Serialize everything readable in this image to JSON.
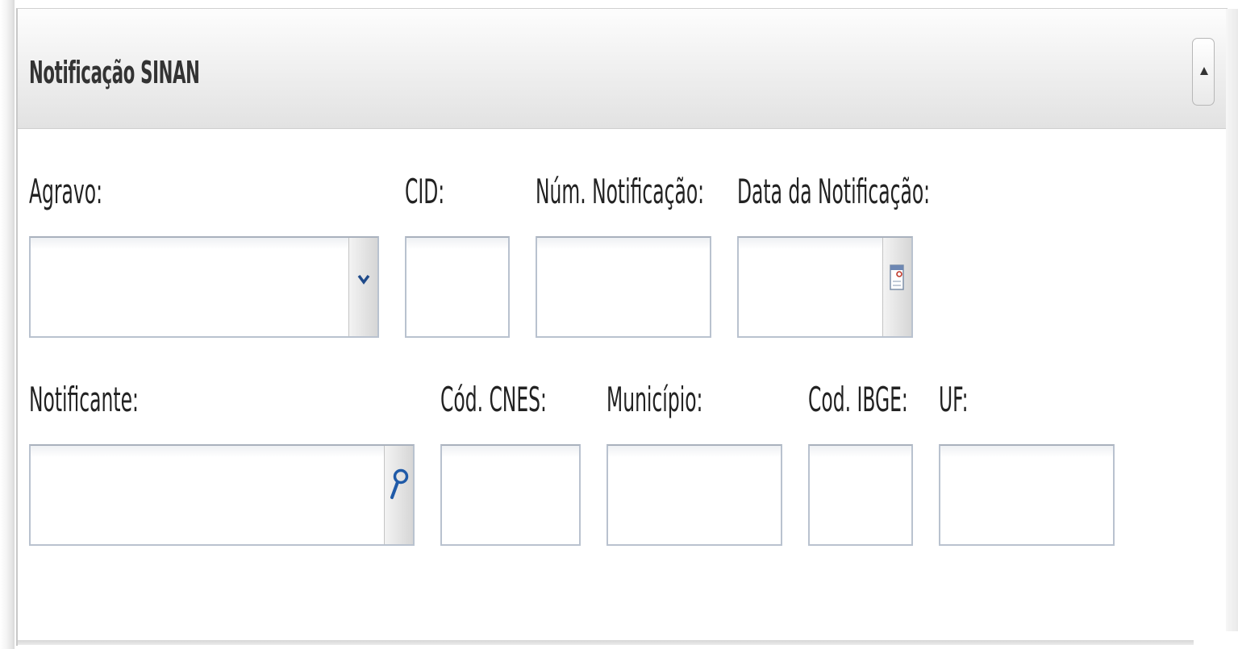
{
  "panel": {
    "title": "Notificação SINAN"
  },
  "fields": {
    "agravo": {
      "label": "Agravo:",
      "value": ""
    },
    "cid": {
      "label": "CID:",
      "value": ""
    },
    "num_notificacao": {
      "label": "Núm. Notificação:",
      "value": ""
    },
    "data_notificacao": {
      "label": "Data da Notificação:",
      "value": ""
    },
    "notificante": {
      "label": "Notificante:",
      "value": ""
    },
    "cod_cnes": {
      "label": "Cód. CNES:",
      "value": ""
    },
    "municipio": {
      "label": "Município:",
      "value": ""
    },
    "cod_ibge": {
      "label": "Cod. IBGE:",
      "value": ""
    },
    "uf": {
      "label": "UF:",
      "value": ""
    }
  },
  "icons": {
    "collapse": "triangle-up-icon",
    "agravo_trigger": "chevron-down-icon",
    "date_trigger": "calendar-icon",
    "notificante_trigger": "search-icon"
  },
  "colors": {
    "header_gradient_top": "#fdfdfd",
    "header_gradient_bottom": "#e2e2e2",
    "field_border": "#b9c2cf",
    "chevron": "#1f4a8a",
    "search_icon": "#1f5aa8"
  }
}
